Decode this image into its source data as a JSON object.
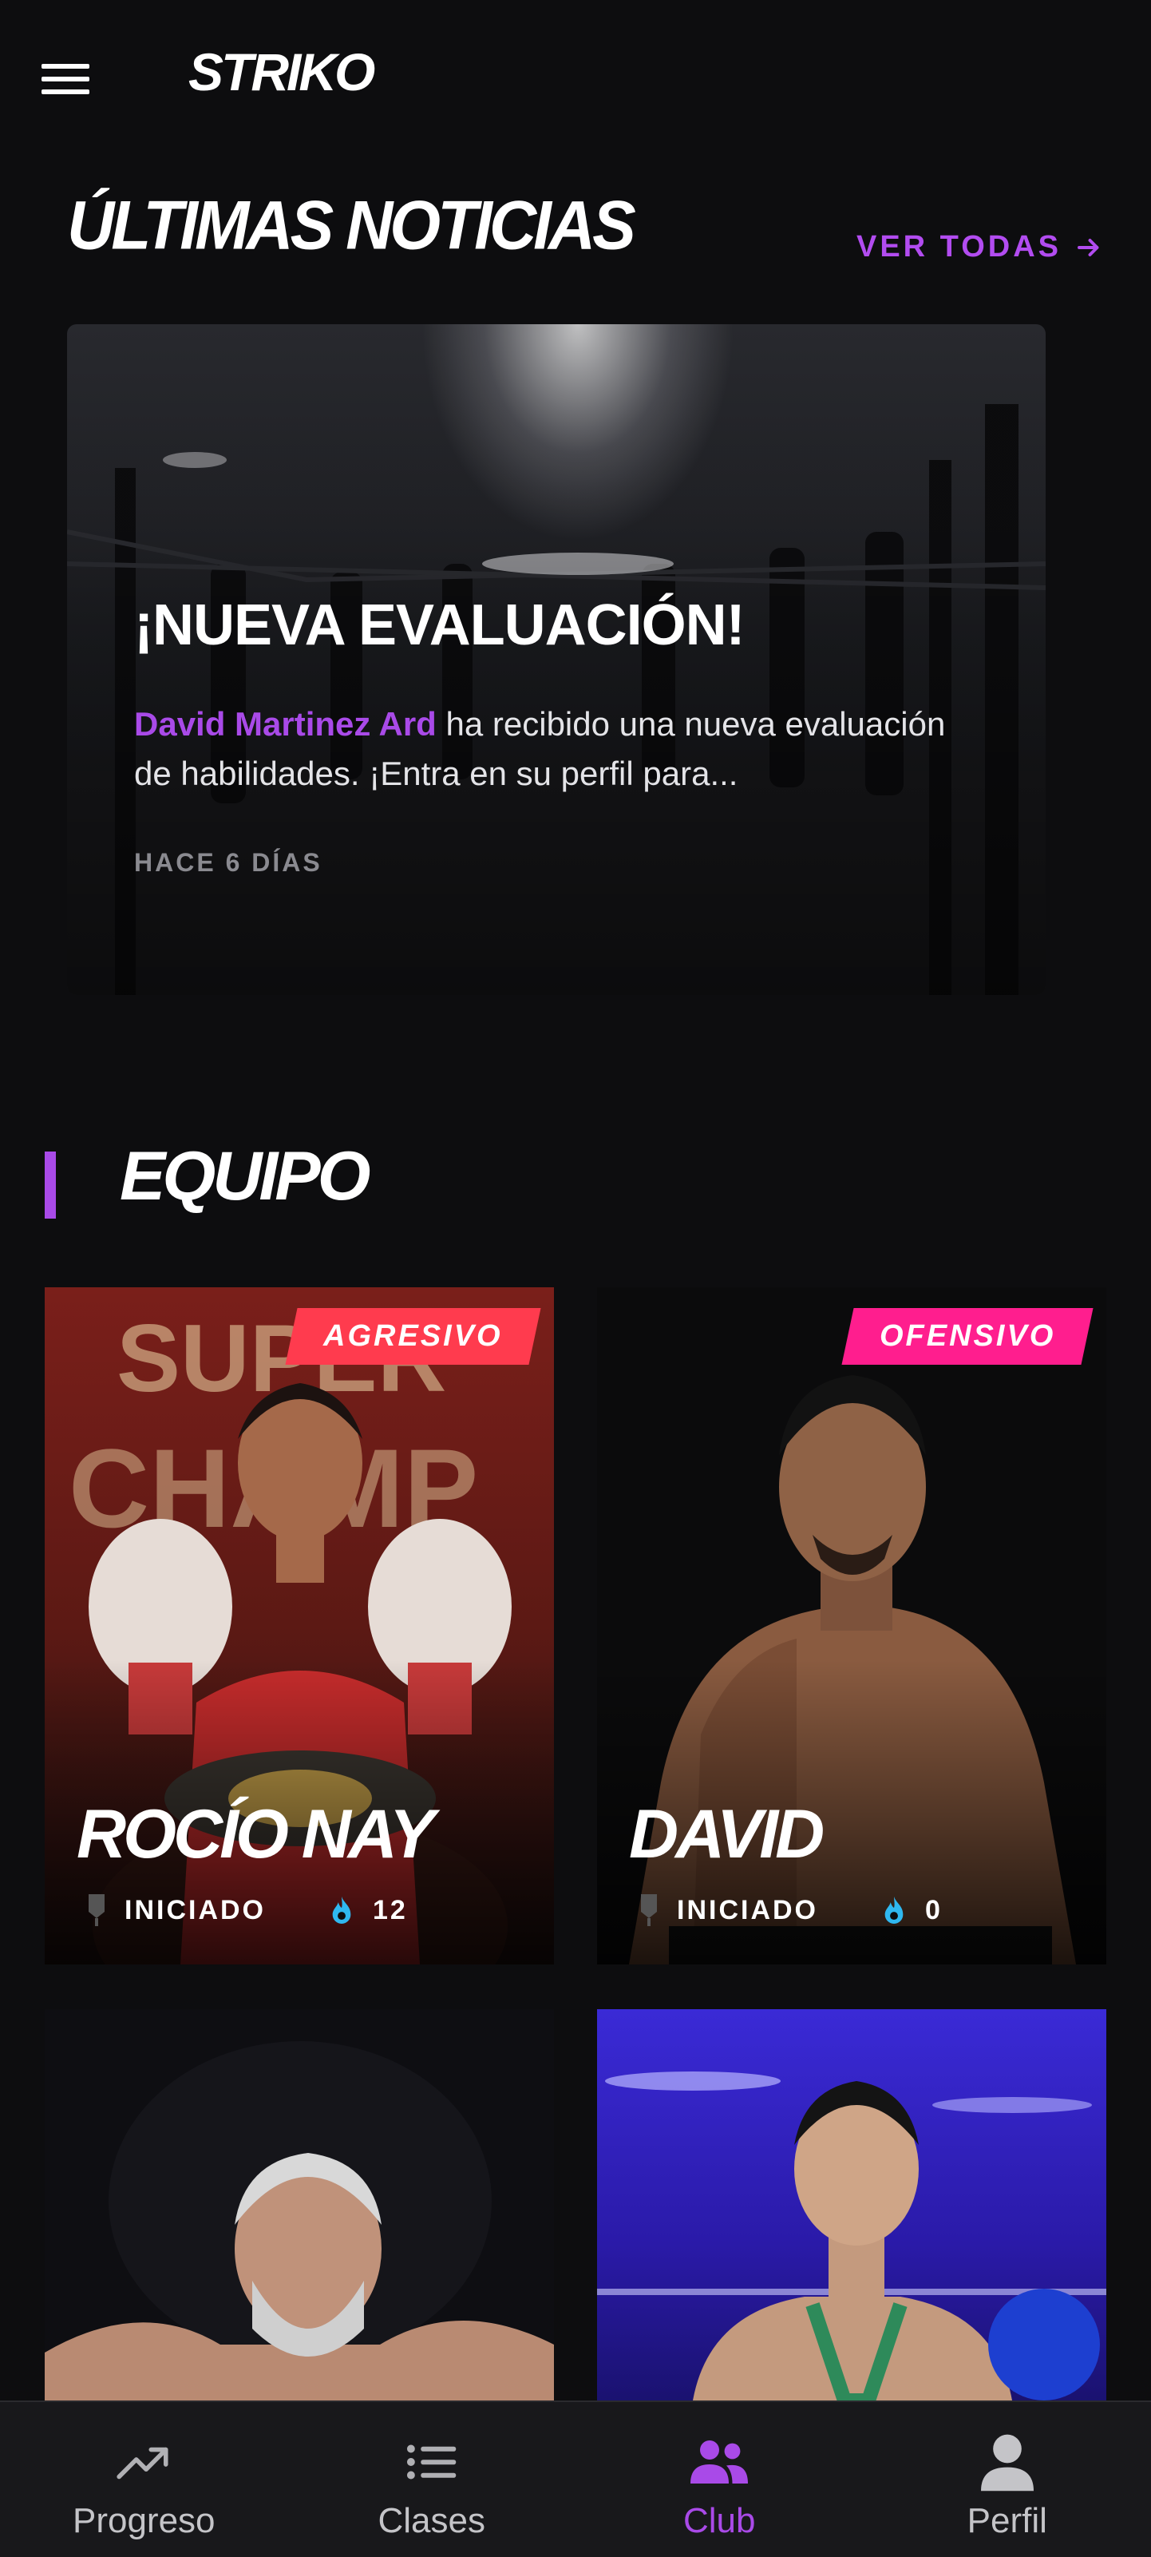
{
  "app": {
    "logo": "STRIKO"
  },
  "colors": {
    "accent": "#a94ae8",
    "tag_red": "#ff3b4e",
    "tag_pink": "#ff1e8e",
    "flame": "#2fb8f0",
    "background": "#0d0d0f"
  },
  "news": {
    "section_title": "ÚLTIMAS NOTICIAS",
    "see_all_label": "VER TODAS",
    "see_all_icon": "arrow-right-icon",
    "card": {
      "headline": "¡NUEVA EVALUACIÓN!",
      "highlight_name": "David Martinez Ard",
      "body_text": " ha recibido una nueva evaluación de habilidades. ¡Entra en su perfil para...",
      "date": "HACE 6 DÍAS"
    }
  },
  "team": {
    "section_title": "EQUIPO",
    "fighters": [
      {
        "name": "ROCÍO NAY",
        "tag": "AGRESIVO",
        "level": "INICIADO",
        "streak": "12",
        "level_icon": "medal-icon",
        "streak_icon": "flame-icon"
      },
      {
        "name": "DAVID",
        "tag": "OFENSIVO",
        "level": "INICIADO",
        "streak": "0",
        "level_icon": "medal-icon",
        "streak_icon": "flame-icon"
      }
    ]
  },
  "nav": {
    "items": [
      {
        "label": "Progreso",
        "icon": "trending-up-icon"
      },
      {
        "label": "Clases",
        "icon": "list-icon"
      },
      {
        "label": "Club",
        "icon": "users-icon"
      },
      {
        "label": "Perfil",
        "icon": "person-icon"
      }
    ],
    "active": "Club"
  }
}
